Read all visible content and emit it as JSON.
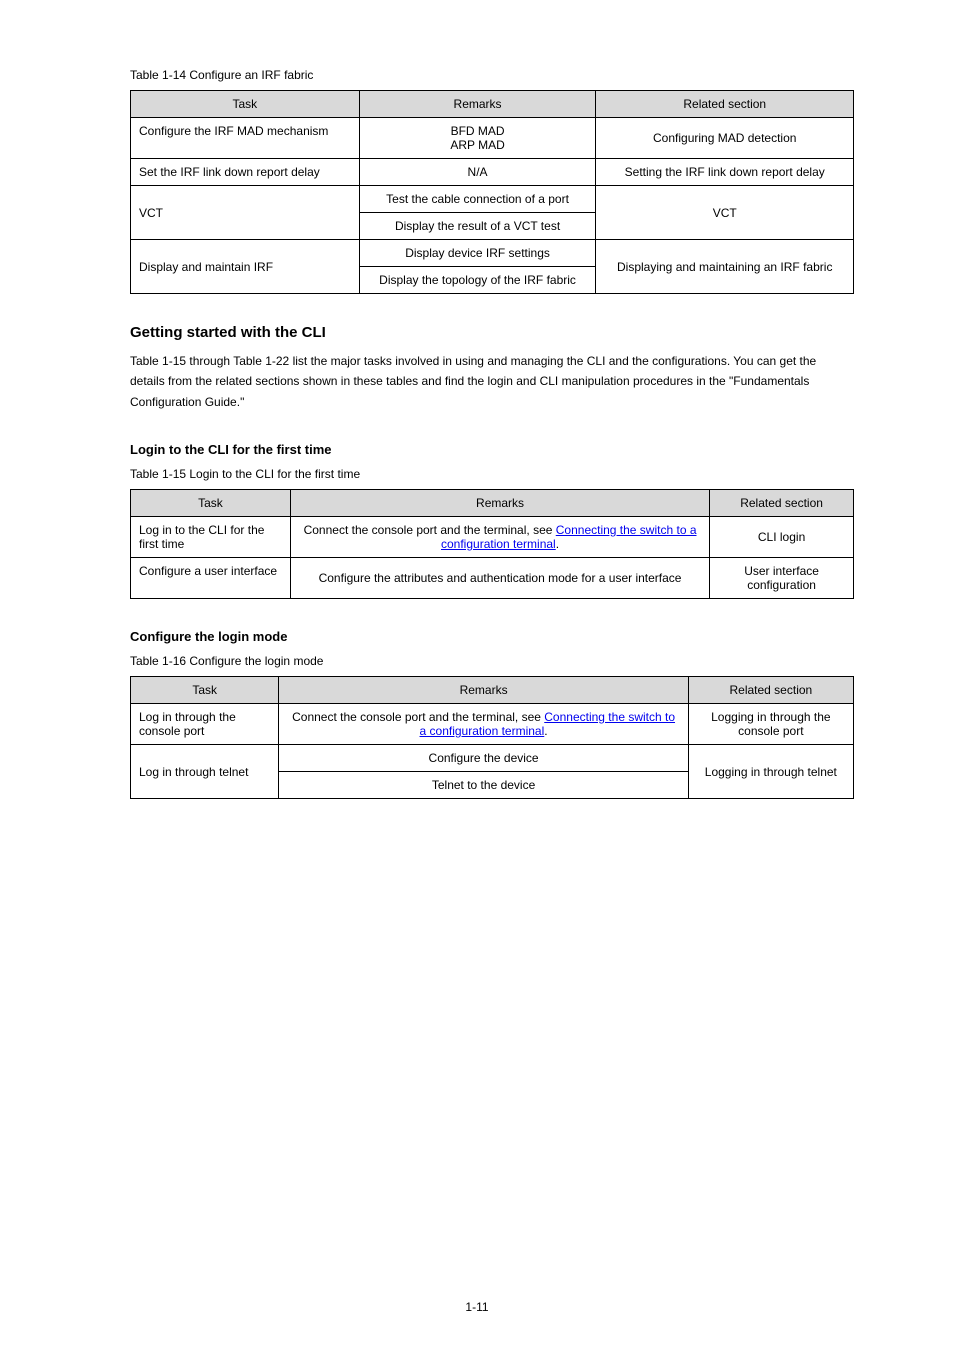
{
  "tableA": {
    "title": "Table 1-14 Configure an IRF fabric",
    "headers": [
      "Task",
      "Remarks",
      "Related section"
    ],
    "rows": [
      {
        "task": "Configure the IRF MAD mechanism",
        "remarks": [
          "BFD MAD",
          "ARP MAD"
        ],
        "section": "Configuring MAD detection"
      },
      {
        "task": "Set the IRF link down report delay",
        "remarks": [
          "N/A"
        ],
        "section": "Setting the IRF link down report delay"
      },
      {
        "task": "VCT",
        "remarks": [
          "Test the cable connection of a port",
          "Display the result of a VCT test"
        ],
        "section": "VCT"
      },
      {
        "task": "Display and maintain IRF",
        "remarks": [
          "Display device IRF settings",
          "Display the topology of the IRF fabric"
        ],
        "section": "Displaying and maintaining an IRF fabric"
      }
    ]
  },
  "intro": {
    "heading": "Getting started with the CLI",
    "text": "Table 1-15 through Table 1-22 list the major tasks involved in using and managing the CLI and the configurations. You can get the details from the related sections shown in these tables and find the login and CLI manipulation procedures in the \"Fundamentals Configuration Guide.\""
  },
  "sectionB": {
    "heading": "Login to the CLI for the first time",
    "tableTitle": "Table 1-15 Login to the CLI for the first time",
    "headers": [
      "Task",
      "Remarks",
      "Related section"
    ],
    "rows": [
      {
        "task": "Log in to the CLI for the first time",
        "remarks": {
          "pre": "Connect the console port and the terminal, see ",
          "linkText": "Connecting the switch to a configuration terminal",
          "post": "."
        },
        "section": "CLI login"
      },
      {
        "task": "Configure a user interface",
        "remarks": "Configure the attributes and authentication mode for a user interface",
        "section": "User interface configuration"
      }
    ]
  },
  "sectionC": {
    "heading": "Configure the login mode",
    "tableTitle": "Table 1-16 Configure the login mode",
    "headers": [
      "Task",
      "Remarks",
      "Related section"
    ],
    "rows": [
      {
        "task": "Log in through the console port",
        "remarks": {
          "pre": "Connect the console port and the terminal, see ",
          "linkText": "Connecting the switch to a configuration terminal",
          "post": "."
        },
        "section": "Logging in through the console port"
      },
      {
        "task": "Log in through telnet",
        "remarksList": [
          "Configure the device",
          "Telnet to the device"
        ],
        "section": "Logging in through telnet"
      }
    ]
  },
  "pageNumber": "1-11"
}
